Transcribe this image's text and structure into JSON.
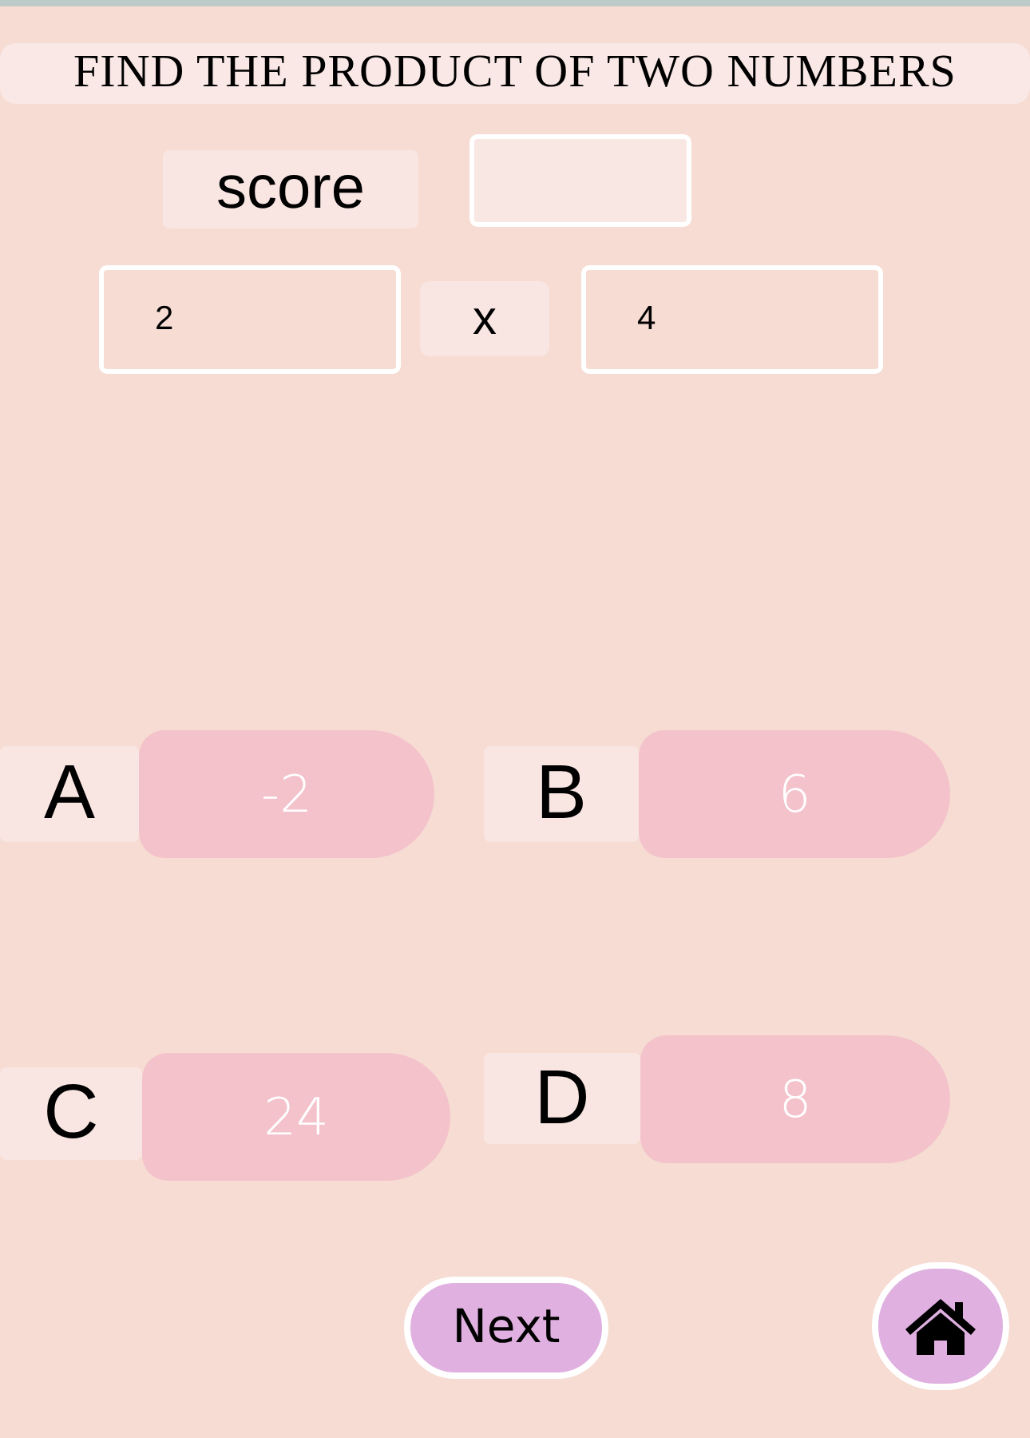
{
  "title": "FIND THE PRODUCT OF TWO NUMBERS",
  "score": {
    "label": "score"
  },
  "operands": [
    {
      "value": "2"
    },
    {
      "value": "4"
    }
  ],
  "operator": "x",
  "options": [
    {
      "letter": "A",
      "answer": "-2"
    },
    {
      "letter": "B",
      "answer": "6"
    },
    {
      "letter": "C",
      "answer": "24"
    },
    {
      "letter": "D",
      "answer": "8"
    }
  ],
  "next_button": {
    "label": "Next"
  }
}
